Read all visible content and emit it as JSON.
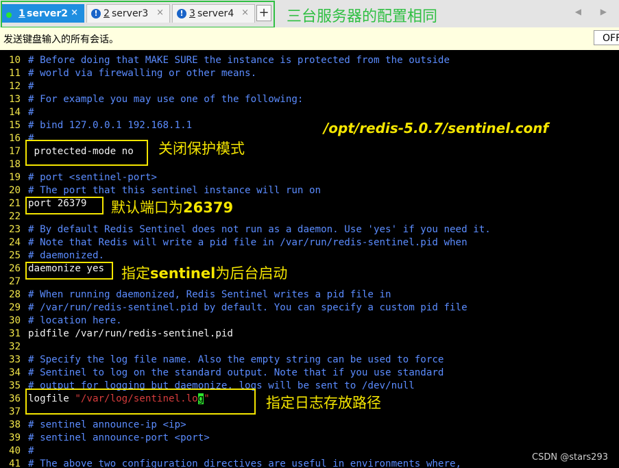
{
  "tabs": [
    {
      "num": "1",
      "name": "server2",
      "close": "×",
      "status": "connected"
    },
    {
      "num": "2",
      "name": "server3",
      "close": "×",
      "status": "warning"
    },
    {
      "num": "3",
      "name": "server4",
      "close": "×",
      "status": "warning"
    }
  ],
  "add_tab_label": "+",
  "tab_annotation": "三台服务器的配置相同",
  "scroll_arrows": "◀ ▶",
  "send_bar": {
    "label": "发送键盘输入的所有会话。",
    "toggle": "OFF"
  },
  "lines": [
    {
      "n": "10",
      "t": "# Before doing that MAKE SURE the instance is protected from the outside",
      "k": "cm"
    },
    {
      "n": "11",
      "t": "# world via firewalling or other means.",
      "k": "cm"
    },
    {
      "n": "12",
      "t": "#",
      "k": "cm"
    },
    {
      "n": "13",
      "t": "# For example you may use one of the following:",
      "k": "cm"
    },
    {
      "n": "14",
      "t": "#",
      "k": "cm"
    },
    {
      "n": "15",
      "t": "# bind 127.0.0.1 192.168.1.1",
      "k": "cm"
    },
    {
      "n": "16",
      "t": "#",
      "k": "cm"
    },
    {
      "n": "17",
      "t": " protected-mode no",
      "k": "pl"
    },
    {
      "n": "18",
      "t": "",
      "k": "pl"
    },
    {
      "n": "19",
      "t": "# port <sentinel-port>",
      "k": "cm"
    },
    {
      "n": "20",
      "t": "# The port that this sentinel instance will run on",
      "k": "cm"
    },
    {
      "n": "21",
      "t": "port 26379",
      "k": "pl"
    },
    {
      "n": "22",
      "t": "",
      "k": "pl"
    },
    {
      "n": "23",
      "t": "# By default Redis Sentinel does not run as a daemon. Use 'yes' if you need it.",
      "k": "cm"
    },
    {
      "n": "24",
      "t": "# Note that Redis will write a pid file in /var/run/redis-sentinel.pid when",
      "k": "cm"
    },
    {
      "n": "25",
      "t": "# daemonized.",
      "k": "cm"
    },
    {
      "n": "26",
      "t": "daemonize yes",
      "k": "pl"
    },
    {
      "n": "27",
      "t": "",
      "k": "pl"
    },
    {
      "n": "28",
      "t": "# When running daemonized, Redis Sentinel writes a pid file in",
      "k": "cm"
    },
    {
      "n": "29",
      "t": "# /var/run/redis-sentinel.pid by default. You can specify a custom pid file",
      "k": "cm"
    },
    {
      "n": "30",
      "t": "# location here.",
      "k": "cm"
    },
    {
      "n": "31",
      "t": "pidfile /var/run/redis-sentinel.pid",
      "k": "pl"
    },
    {
      "n": "32",
      "t": "",
      "k": "pl"
    },
    {
      "n": "33",
      "t": "# Specify the log file name. Also the empty string can be used to force",
      "k": "cm"
    },
    {
      "n": "34",
      "t": "# Sentinel to log on the standard output. Note that if you use standard",
      "k": "cm"
    },
    {
      "n": "35",
      "t": "# output for logging but daemonize, logs will be sent to /dev/null",
      "k": "cm"
    },
    {
      "n": "36",
      "t": "",
      "k": "logfile"
    },
    {
      "n": "37",
      "t": "",
      "k": "pl"
    },
    {
      "n": "38",
      "t": "# sentinel announce-ip <ip>",
      "k": "cm"
    },
    {
      "n": "39",
      "t": "# sentinel announce-port <port>",
      "k": "cm"
    },
    {
      "n": "40",
      "t": "#",
      "k": "cm"
    },
    {
      "n": "41",
      "t": "# The above two configuration directives are useful in environments where,",
      "k": "cm"
    }
  ],
  "logfile_line": {
    "keyword": "logfile ",
    "string_before": "\"/var/log/sentinel.lo",
    "cursor_char": "g",
    "string_after": "\""
  },
  "annotations": {
    "path": "/opt/redis-5.0.7/sentinel.conf",
    "protected": "关闭保护模式",
    "port_prefix": "默认端口为",
    "port_value": "26379",
    "daemon_prefix": "指定",
    "daemon_bold": "sentinel",
    "daemon_suffix": "为后台启动",
    "logfile": "指定日志存放路径"
  },
  "watermark": "CSDN @stars293",
  "colors": {
    "tab_active": "#1f8ee0",
    "line_number": "#f2e64a",
    "comment": "#5b8cff",
    "annotation": "#f5e600",
    "highlight_box": "#f5e600",
    "group_box": "#2fbf42"
  }
}
